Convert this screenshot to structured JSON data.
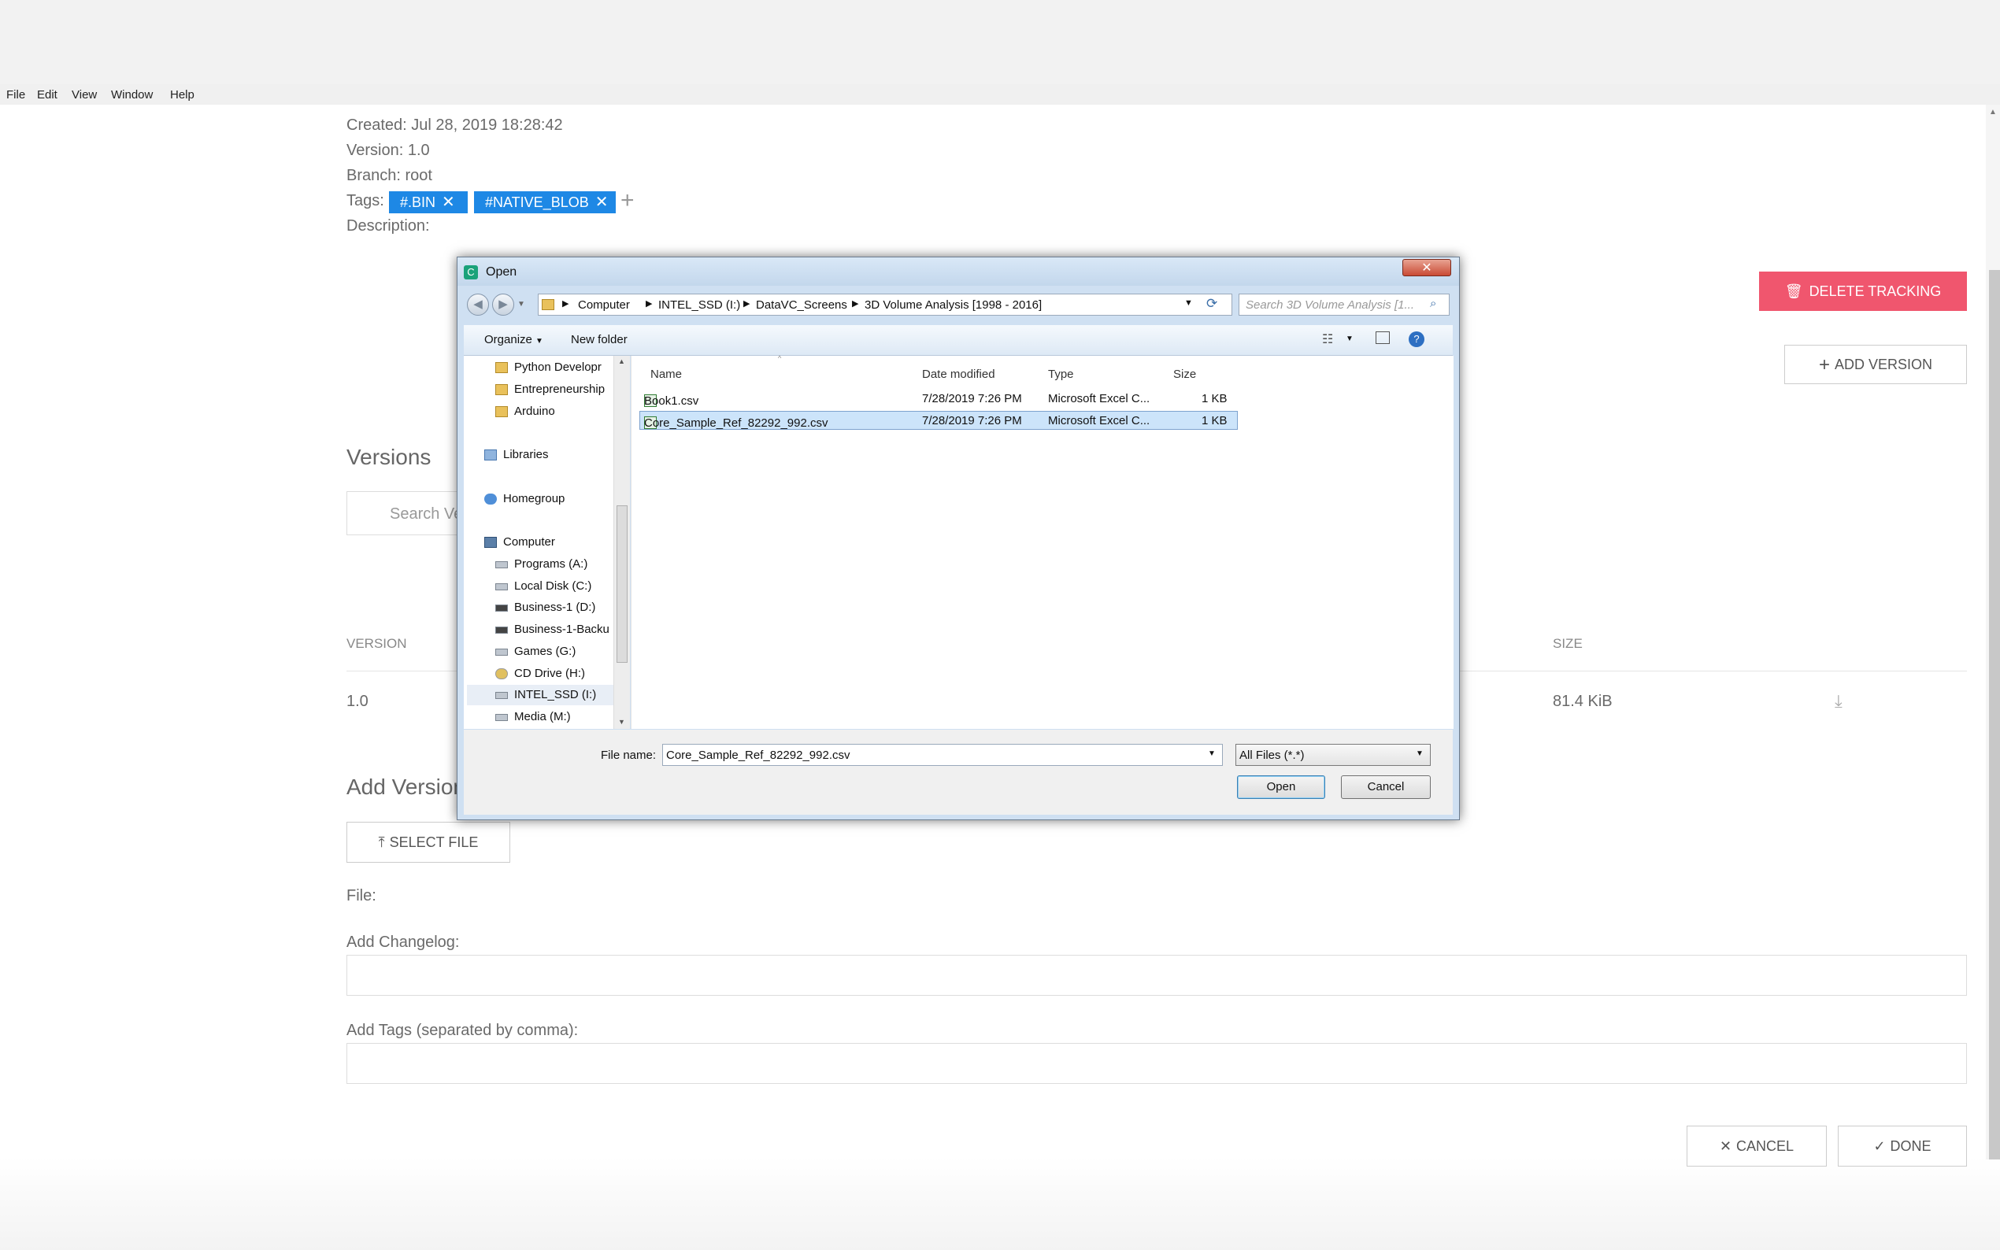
{
  "menu": [
    "File",
    "Edit",
    "View",
    "Window",
    "Help"
  ],
  "details": {
    "created": "Created: Jul 28, 2019 18:28:42",
    "version": "Version: 1.0",
    "branch": "Branch: root",
    "tags_label": "Tags:",
    "tags": [
      "#.BIN",
      "#NATIVE_BLOB"
    ],
    "description_label": "Description:"
  },
  "actions": {
    "delete_tracking": "DELETE TRACKING",
    "add_version": "ADD VERSION"
  },
  "versions": {
    "heading": "Versions",
    "search_placeholder": "Search Ve",
    "col_version": "VERSION",
    "col_size": "SIZE",
    "rows": [
      {
        "version": "1.0",
        "size": "81.4 KiB"
      }
    ]
  },
  "add_version": {
    "heading": "Add Version",
    "select_file": "SELECT FILE",
    "file_label": "File:",
    "changelog_label": "Add Changelog:",
    "tags_label": "Add Tags (separated by comma):",
    "cancel": "CANCEL",
    "done": "DONE"
  },
  "dialog": {
    "title": "Open",
    "breadcrumb": [
      "Computer",
      "INTEL_SSD (I:)",
      "DataVC_Screens",
      "3D Volume Analysis [1998 - 2016]"
    ],
    "search_placeholder": "Search 3D Volume Analysis [1...",
    "organize": "Organize",
    "new_folder": "New folder",
    "nav": [
      {
        "label": "Python Developr",
        "icon": "folder-icon"
      },
      {
        "label": "Entrepreneurship",
        "icon": "folder-icon"
      },
      {
        "label": "Arduino",
        "icon": "folder-icon"
      },
      {
        "label": "Libraries",
        "icon": "libraries-icon"
      },
      {
        "label": "Homegroup",
        "icon": "homegroup-icon"
      },
      {
        "label": "Computer",
        "icon": "computer-icon"
      },
      {
        "label": "Programs (A:)",
        "icon": "drive-icon"
      },
      {
        "label": "Local Disk (C:)",
        "icon": "drive-icon"
      },
      {
        "label": "Business-1 (D:)",
        "icon": "drive-icon"
      },
      {
        "label": "Business-1-Backu",
        "icon": "drive-icon"
      },
      {
        "label": "Games (G:)",
        "icon": "drive-icon"
      },
      {
        "label": "CD Drive (H:)",
        "icon": "cd-icon"
      },
      {
        "label": "INTEL_SSD (I:)",
        "icon": "drive-icon"
      },
      {
        "label": "Media (M:)",
        "icon": "drive-icon"
      }
    ],
    "columns": [
      "Name",
      "Date modified",
      "Type",
      "Size"
    ],
    "files": [
      {
        "name": "Book1.csv",
        "date": "7/28/2019 7:26 PM",
        "type": "Microsoft Excel C...",
        "size": "1 KB"
      },
      {
        "name": "Core_Sample_Ref_82292_992.csv",
        "date": "7/28/2019 7:26 PM",
        "type": "Microsoft Excel C...",
        "size": "1 KB"
      }
    ],
    "filename_label": "File name:",
    "filename_value": "Core_Sample_Ref_82292_992.csv",
    "filter": "All Files (*.*)",
    "open": "Open",
    "cancel": "Cancel"
  },
  "colors": {
    "danger": "#f0566e",
    "tag": "#1e88e5",
    "selection": "#cce4fa"
  }
}
